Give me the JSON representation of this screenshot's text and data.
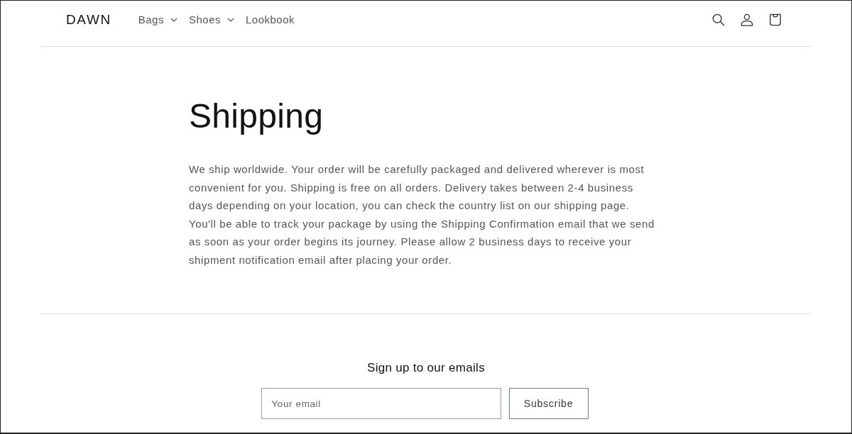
{
  "header": {
    "logo": "DAWN",
    "nav": [
      {
        "label": "Bags",
        "kind": "dropdown"
      },
      {
        "label": "Shoes",
        "kind": "dropdown"
      },
      {
        "label": "Lookbook",
        "kind": "link"
      }
    ]
  },
  "page": {
    "title": "Shipping",
    "body": "We ship worldwide. Your order will be carefully packaged and delivered wherever is most convenient for you. Shipping is free on all orders. Delivery takes between 2-4 business days depending on your location, you can check the country list on our shipping page. You'll be able to track your package by using the Shipping Confirmation email that we send as soon as your order begins its journey. Please allow 2 business days to receive your shipment notification email after placing your order."
  },
  "newsletter": {
    "heading": "Sign up to our emails",
    "email_field": {
      "placeholder": "Your email"
    },
    "button": "Subscribe"
  }
}
